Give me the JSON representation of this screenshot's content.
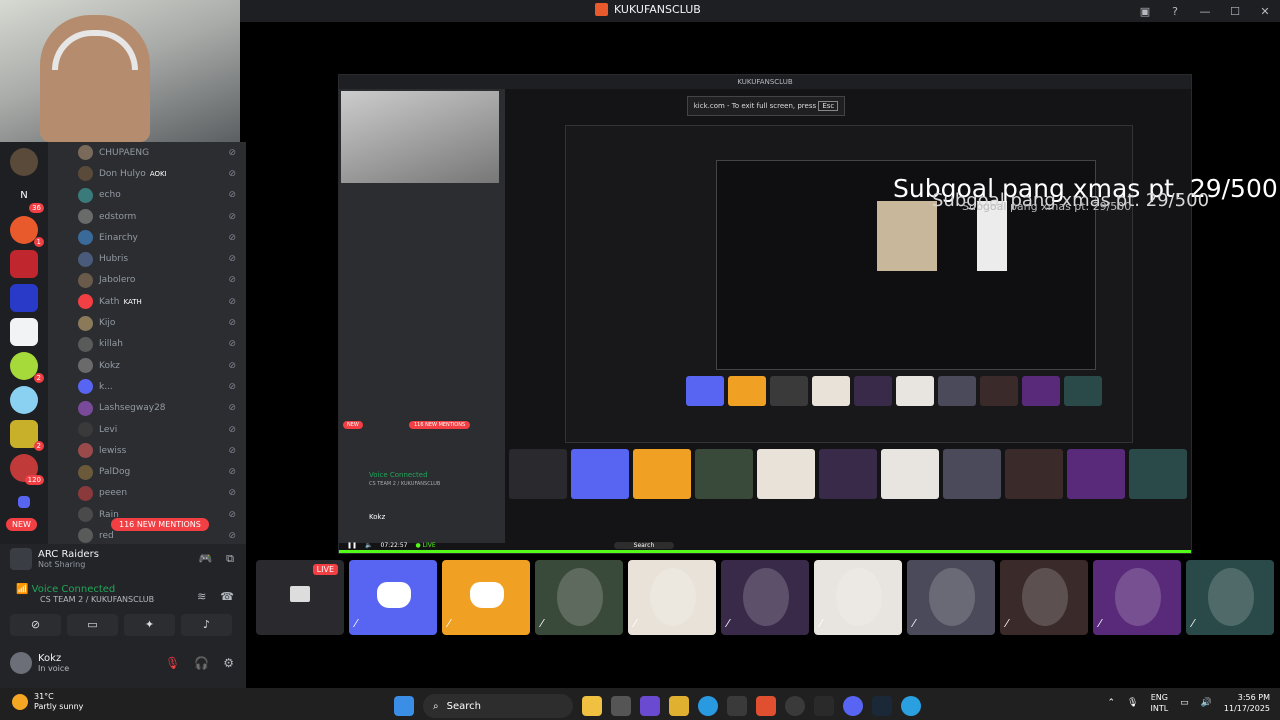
{
  "window": {
    "title": "KUKUFANSCLUB"
  },
  "members": [
    {
      "name": "CHUPAENG",
      "color": "#7a6a5a"
    },
    {
      "name": "Don Hulyo",
      "tag": "AOKI",
      "color": "#5a4a3a"
    },
    {
      "name": "echo",
      "color": "#3a7a7a"
    },
    {
      "name": "edstorm",
      "color": "#6a6a6a"
    },
    {
      "name": "Einarchy",
      "color": "#3a6a9a"
    },
    {
      "name": "Hubris",
      "color": "#4a5a7a"
    },
    {
      "name": "Jabolero",
      "color": "#6a5a4a"
    },
    {
      "name": "Kath",
      "tag": "KATH",
      "color": "#f23f43"
    },
    {
      "name": "Kijo",
      "color": "#8a7a5a"
    },
    {
      "name": "killah",
      "color": "#5a5a5a"
    },
    {
      "name": "Kokz",
      "color": "#6a6a6a"
    },
    {
      "name": "k...",
      "color": "#5865f2"
    },
    {
      "name": "Lashsegway28",
      "color": "#7a4a9a"
    },
    {
      "name": "Levi",
      "color": "#3a3a3a"
    },
    {
      "name": "lewiss",
      "color": "#9a4a4a"
    },
    {
      "name": "PalDog",
      "color": "#6a5a3a"
    },
    {
      "name": "peeen",
      "color": "#8a3a3a"
    },
    {
      "name": "Rain",
      "color": "#4a4a4a"
    },
    {
      "name": "red",
      "color": "#5a5a5a"
    }
  ],
  "server_badges": [
    "N",
    "36",
    "1",
    "2",
    "2",
    "2",
    "120"
  ],
  "new_label": "NEW",
  "mentions_label": "116 NEW MENTIONS",
  "activity": {
    "title": "ARC Raiders",
    "status": "Not Sharing"
  },
  "voice": {
    "status": "Voice Connected",
    "channel": "CS TEAM 2 / KUKUFANSCLUB"
  },
  "user": {
    "name": "Kokz",
    "status": "In voice"
  },
  "stream": {
    "subgoal_text": "Subgoal pang xmas pt. 29/500",
    "fullscreen_hint": "kick.com - To exit full screen, press",
    "fullscreen_key": "Esc",
    "inner_title": "KUKUFANSCLUB",
    "inner_time": "07:22:57",
    "live_label": "LIVE",
    "inner_search": "Search",
    "inner_voice": "Voice Connected",
    "inner_voice_channel": "CS TEAM 2 / KUKUFANSCLUB",
    "inner_user": "Kokz",
    "inner_mentions": "116 NEW MENTIONS",
    "inner_new": "NEW"
  },
  "tiles": [
    {
      "type": "screen",
      "color": "#2a2a2e",
      "live": "LIVE"
    },
    {
      "type": "discord",
      "color": "#5865f2"
    },
    {
      "type": "discord",
      "color": "#f0a022"
    },
    {
      "type": "photo",
      "color": "#3a4a3a"
    },
    {
      "type": "photo",
      "color": "#e8e2d8"
    },
    {
      "type": "photo",
      "color": "#3a2a4a"
    },
    {
      "type": "photo",
      "color": "#e8e4e0"
    },
    {
      "type": "photo",
      "color": "#4a4a5a"
    },
    {
      "type": "photo",
      "color": "#3a2a2a"
    },
    {
      "type": "photo",
      "color": "#5a2a7a"
    },
    {
      "type": "photo",
      "color": "#2a4a4a"
    }
  ],
  "taskbar": {
    "weather_temp": "31°C",
    "weather_desc": "Partly sunny",
    "search_placeholder": "Search",
    "lang1": "ENG",
    "lang2": "INTL",
    "time": "3:56 PM",
    "date": "11/17/2025"
  }
}
